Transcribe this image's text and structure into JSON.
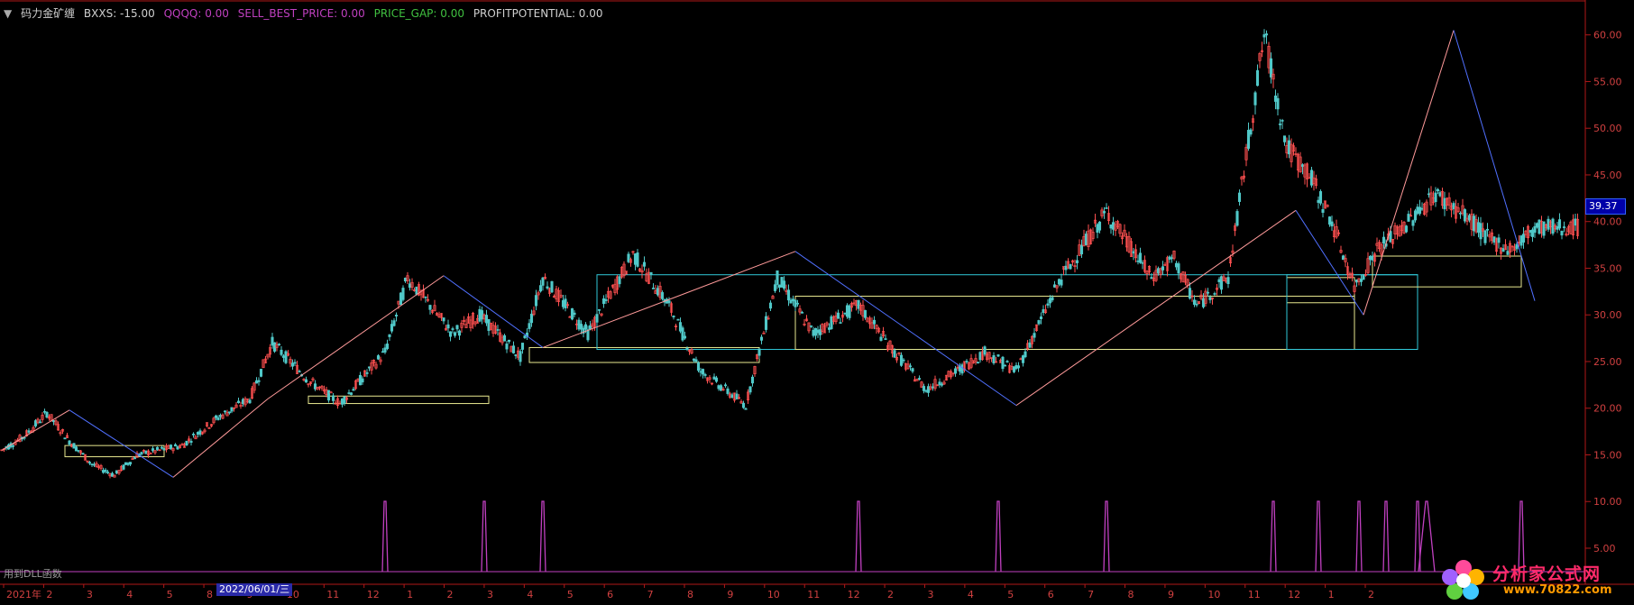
{
  "header": {
    "name": "码力金矿缠",
    "bxxs": "BXXS: -15.00",
    "qqqq": "QQQQ: 0.00",
    "sell_best_price": "SELL_BEST_PRICE: 0.00",
    "price_gap": "PRICE_GAP: 0.00",
    "profit_potential": "PROFITPOTENTIAL: 0.00"
  },
  "current_price": "39.37",
  "cursor_date": "2022/06/01/三",
  "indicator_label": "用到DLL函数",
  "watermark": {
    "line1": "分析家公式网",
    "line2": "www.70822.com"
  },
  "colors": {
    "background": "#000000",
    "axis": "#b01818",
    "up": "#ff5050",
    "down": "#50c8c8",
    "yellow_box": "#e8e890",
    "cyan_box": "#30c8d8",
    "pink_line": "#ff9a9a",
    "blue_line": "#5070ff",
    "indicator": "#c040c0",
    "tick_text": "#d04040",
    "header_text": "#d0d0d0",
    "qqqq": "#c040c0",
    "price_gap": "#40c040"
  },
  "chart_data": {
    "type": "candlestick",
    "ylim": [
      5,
      62
    ],
    "yticks": [
      "60.00",
      "55.00",
      "50.00",
      "45.00",
      "40.00",
      "35.00",
      "30.00",
      "25.00",
      "20.00",
      "15.00",
      "10.00",
      "5.00"
    ],
    "ytick_values": [
      60,
      55,
      50,
      45,
      40,
      35,
      30,
      25,
      20,
      15,
      10,
      5
    ],
    "xtick_labels": [
      "2021年",
      "2",
      "3",
      "4",
      "5",
      "8",
      "9",
      "10",
      "11",
      "12",
      "1",
      "2",
      "3",
      "4",
      "5",
      "6",
      "7",
      "8",
      "9",
      "10",
      "11",
      "12",
      "2",
      "3",
      "4",
      "5",
      "6",
      "7",
      "8",
      "9",
      "10",
      "11",
      "12",
      "1",
      "2"
    ],
    "price_path_weeks": [
      0,
      5,
      10,
      15,
      20,
      25,
      30,
      40,
      48,
      55,
      60,
      68,
      75,
      85,
      90,
      100,
      106,
      115,
      120,
      130,
      140,
      148,
      155,
      165,
      172,
      180,
      190,
      198,
      205,
      212,
      218,
      225,
      235,
      245,
      255,
      260,
      265,
      272,
      280,
      285,
      290,
      295,
      300,
      305,
      310,
      318,
      326,
      330,
      335,
      340,
      345
    ],
    "price_path_values": [
      15.5,
      17,
      19.5,
      16.5,
      14,
      12.8,
      15,
      16,
      19,
      21,
      27,
      23,
      20.5,
      26,
      34,
      28,
      30,
      25.5,
      34,
      28,
      36.5,
      31,
      24,
      20.3,
      34,
      28,
      31,
      26,
      22,
      24,
      26,
      24,
      34,
      41,
      34,
      36,
      31,
      34,
      60,
      48,
      45,
      40,
      33,
      37,
      39,
      43,
      40,
      38,
      37,
      39.4,
      39.4
    ],
    "zigzag_weeks": [
      0,
      15,
      38,
      59,
      98,
      120,
      176,
      225,
      287,
      302,
      322,
      340
    ],
    "zigzag_values": [
      15.5,
      19.8,
      12.6,
      21,
      34.2,
      26.5,
      36.8,
      20.3,
      41.2,
      30,
      60.5,
      31.5
    ],
    "boxes": [
      {
        "color": "yellow",
        "weeks": [
          14,
          36
        ],
        "range": [
          14.8,
          16
        ]
      },
      {
        "color": "yellow",
        "weeks": [
          68,
          108
        ],
        "range": [
          20.5,
          21.3
        ]
      },
      {
        "color": "yellow",
        "weeks": [
          117,
          168
        ],
        "range": [
          24.9,
          26.5
        ]
      },
      {
        "color": "cyan",
        "weeks": [
          132,
          314
        ],
        "range": [
          26.3,
          34.3
        ]
      },
      {
        "color": "yellow",
        "weeks": [
          176,
          300
        ],
        "range": [
          26.3,
          32
        ]
      },
      {
        "color": "yellow",
        "weeks": [
          285,
          300
        ],
        "range": [
          31.3,
          34
        ]
      },
      {
        "color": "cyan",
        "weeks": [
          285,
          314
        ],
        "range": [
          26.3,
          34.3
        ]
      },
      {
        "color": "yellow",
        "weeks": [
          304,
          337
        ],
        "range": [
          33,
          36.3
        ]
      }
    ],
    "signal_weeks": [
      85,
      107,
      120,
      190,
      221,
      245,
      282,
      292,
      301,
      307,
      314,
      316,
      337
    ],
    "signal_widths": [
      1,
      1,
      1,
      1,
      1,
      1,
      1,
      1,
      1,
      1,
      1,
      2,
      1
    ],
    "total_weeks": 350
  }
}
